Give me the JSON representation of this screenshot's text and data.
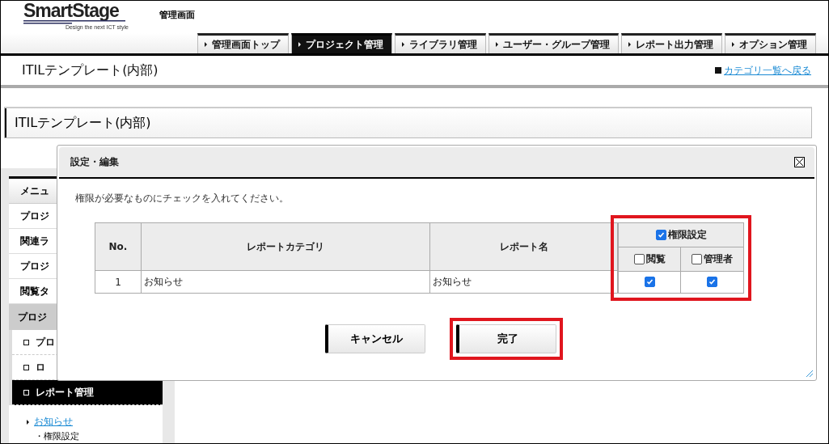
{
  "header": {
    "logo": {
      "name": "SmartStage",
      "tagline": "Design the next ICT style"
    },
    "title": "管理画面"
  },
  "nav_tabs": [
    {
      "label": "管理画面トップ",
      "selected": false
    },
    {
      "label": "プロジェクト管理",
      "selected": true
    },
    {
      "label": "ライブラリ管理",
      "selected": false
    },
    {
      "label": "ユーザー・グループ管理",
      "selected": false
    },
    {
      "label": "レポート出力管理",
      "selected": false
    },
    {
      "label": "オプション管理",
      "selected": false
    }
  ],
  "page_title": "ITILテンプレート(内部)",
  "back_link": "カテゴリ一覧へ戻る",
  "panel_title": "ITILテンプレート(内部)",
  "sidebar": {
    "header": "メニュ",
    "items": [
      {
        "label": "プロジ"
      },
      {
        "label": "関連ラ"
      },
      {
        "label": "プロジ"
      },
      {
        "label": "閲覧タ"
      }
    ],
    "section": {
      "label": "プロジ",
      "items": [
        {
          "label": "プロ",
          "selected": false
        },
        {
          "label": "ロ",
          "selected": false
        },
        {
          "label": "レポート管理",
          "selected": true
        }
      ]
    },
    "links": [
      {
        "label": "お知らせ",
        "children": [
          {
            "label": "・権限設定"
          }
        ]
      }
    ]
  },
  "dialog": {
    "title": "設定・編集",
    "instruction": "権限が必要なものにチェックを入れてください。",
    "table": {
      "columns": [
        "No.",
        "レポートカテゴリ",
        "レポート名"
      ],
      "permission_group": {
        "label": "権限設定",
        "checked": true,
        "highlighted": true,
        "columns": [
          {
            "label": "閲覧",
            "checked": false
          },
          {
            "label": "管理者",
            "checked": false
          }
        ]
      },
      "rows": [
        {
          "no": "1",
          "category": "お知らせ",
          "name": "お知らせ",
          "permissions": [
            true,
            true
          ]
        }
      ]
    },
    "buttons": [
      {
        "label": "キャンセル",
        "highlighted": false
      },
      {
        "label": "完了",
        "highlighted": true
      }
    ]
  }
}
